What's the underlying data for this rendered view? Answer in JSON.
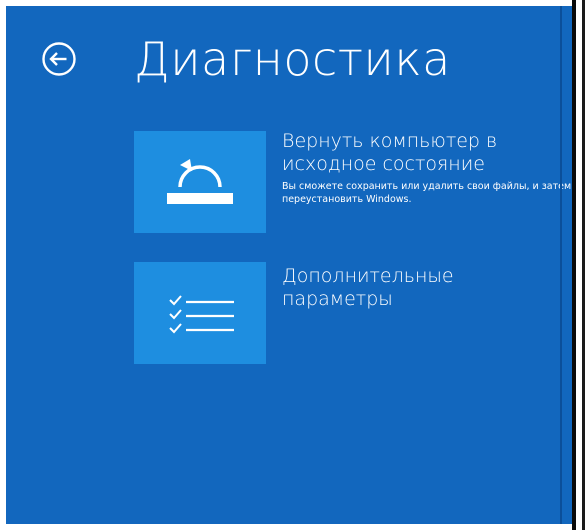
{
  "page": {
    "title": "Диагностика"
  },
  "options": [
    {
      "title_line1": "Вернуть компьютер в",
      "title_line2": "исходное состояние",
      "description": "Вы сможете сохранить или удалить свои файлы, и затем переустановить Windows.",
      "icon": "reset-icon"
    },
    {
      "title_line1": "Дополнительные",
      "title_line2": "параметры",
      "description": "",
      "icon": "checklist-icon"
    }
  ],
  "colors": {
    "background": "#1267be",
    "tile": "#1e8ee0",
    "text": "#ffffff"
  }
}
